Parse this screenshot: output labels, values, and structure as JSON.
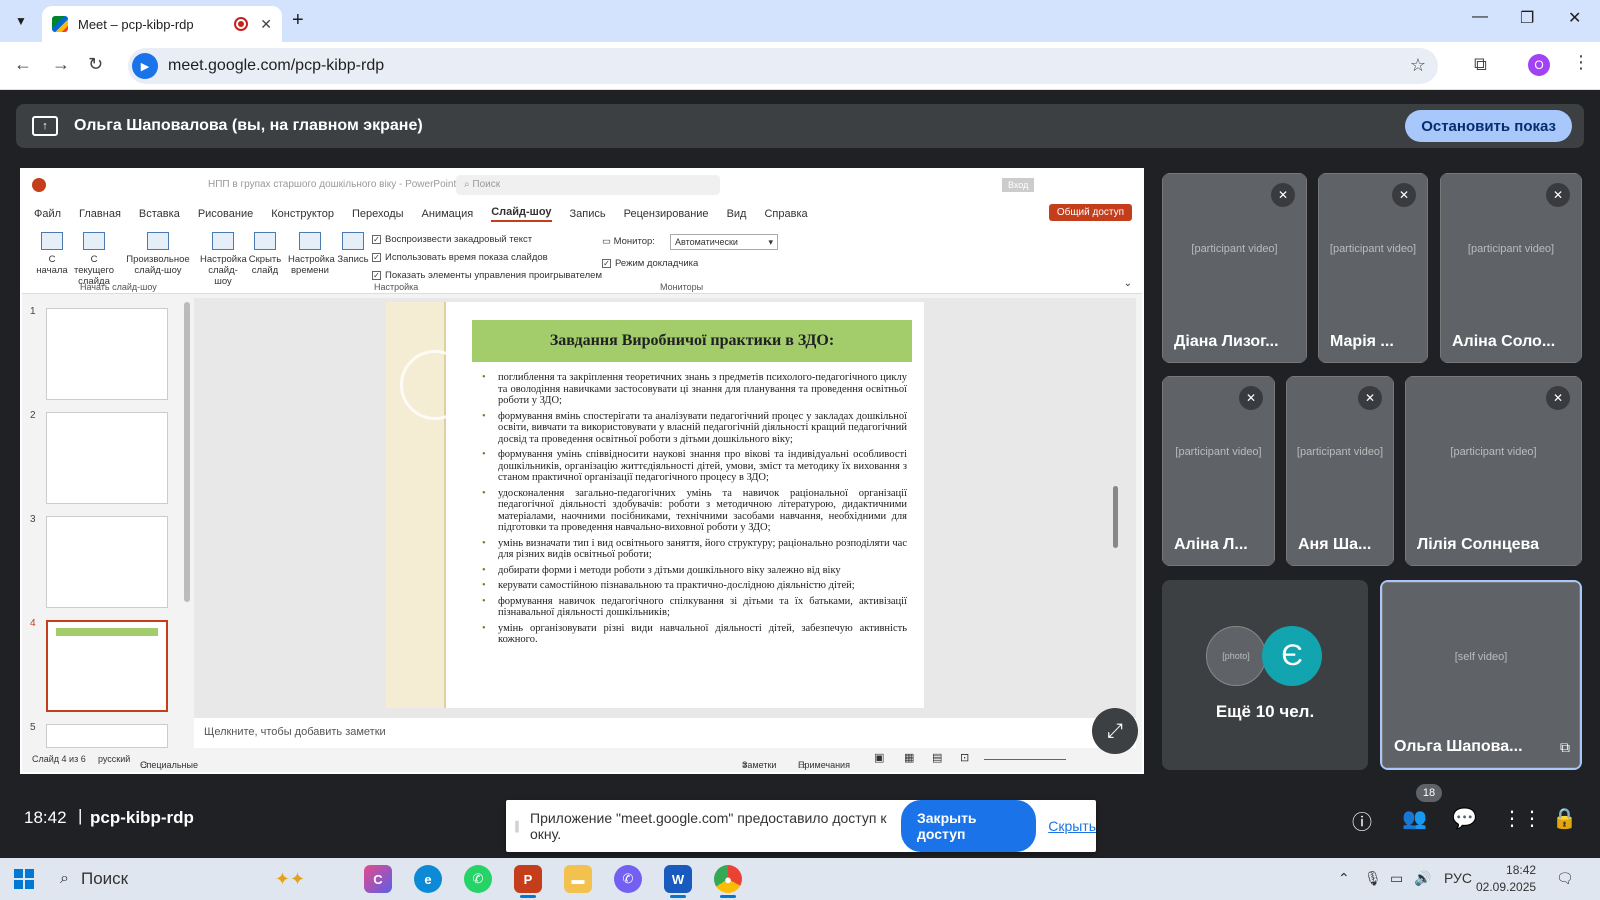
{
  "browser": {
    "tab_title": "Meet – pcp-kibp-rdp",
    "url": "meet.google.com/pcp-kibp-rdp",
    "profile_initial": "O"
  },
  "presentation": {
    "label": "Ольга Шаповалова (вы, на главном экране)",
    "stop_button": "Остановить показ"
  },
  "ppt": {
    "file_title": "НПП в групах старшого дошкільного віку - PowerPoint",
    "search_placeholder": "Поиск",
    "signin": "Вход",
    "menu": [
      "Файл",
      "Главная",
      "Вставка",
      "Рисование",
      "Конструктор",
      "Переходы",
      "Анимация",
      "Слайд-шоу",
      "Запись",
      "Рецензирование",
      "Вид",
      "Справка"
    ],
    "active_menu": "Слайд-шоу",
    "share_button": "Общий доступ",
    "ribbon": {
      "from_start": "С начала",
      "from_current": "С текущего слайда",
      "custom_show": "Произвольное слайд-шоу",
      "setup_show": "Настройка слайд-шоу",
      "hide_slide": "Скрыть слайд",
      "rehearse": "Настройка времени",
      "record": "Запись",
      "check_narration": "Воспроизвести закадровый текст",
      "check_timings": "Использовать время показа слайдов",
      "check_controls": "Показать элементы управления проигрывателем",
      "monitor_label": "Монитор:",
      "monitor_value": "Автоматически",
      "presenter_view": "Режим докладчика",
      "group_start": "Начать слайд-шоу",
      "group_setup": "Настройка",
      "group_monitors": "Мониторы"
    },
    "thumbs": [
      "1",
      "2",
      "3",
      "4",
      "5"
    ],
    "slide": {
      "heading": "Завдання Виробничої практики в ЗДО:",
      "bullets": [
        "поглиблення та закріплення теоретичних знань з предметів психолого-педагогічного циклу та оволодіння навичками застосовувати ці знання для планування та проведення освітньої роботи у ЗДО;",
        "формування вмінь спостерігати та аналізувати педагогічний процес у закладах дошкільної освіти, вивчати та використовувати у власній педагогічній діяльності кращий педагогічний досвід та проведення освітньої роботи з дітьми дошкільного віку;",
        "формування умінь співвідносити наукові знання про вікові та індивідуальні особливості дошкільників, організацію життєдіяльності дітей, умови, зміст та методику їх виховання з станом практичної організації педагогічного процесу в ЗДО;",
        "удосконалення загально-педагогічних умінь та навичок раціональної організації педагогічної діяльності здобувачів: роботи з методичною літературою, дидактичними матеріалами, наочними посібниками, технічними засобами навчання, необхідними для підготовки та проведення навчально-виховної роботи у ЗДО;",
        "умінь визначати тип і вид освітнього заняття, його структуру; раціонально розподіляти час для різних видів освітньої роботи;",
        "добирати форми і методи роботи з дітьми дошкільного віку залежно від віку",
        "керувати самостійною пізнавальною та практично-дослідною діяльністю дітей;",
        "формування навичок педагогічного спілкування зі дітьми та їх батьками, активізації пізнавальної діяльності дошкільників;",
        "умінь організовувати різні види навчальної діяльності дітей, забезпечую активність кожного."
      ]
    },
    "notes_placeholder": "Щелкните, чтобы добавить заметки",
    "status": {
      "slide_counter": "Слайд 4 из 6",
      "language": "русский",
      "accessibility": "Специальные возможности: все в порядке",
      "notes": "Заметки",
      "comments": "Примечания"
    }
  },
  "participants": [
    {
      "name": "Діана Лизог...",
      "muted": true
    },
    {
      "name": "Марія ...",
      "muted": true
    },
    {
      "name": "Аліна Соло...",
      "muted": true
    },
    {
      "name": "Аліна Л...",
      "muted": true
    },
    {
      "name": "Аня Ша...",
      "muted": true
    },
    {
      "name": "Лілія Солнцева",
      "muted": true
    }
  ],
  "more": {
    "label": "Ещё 10 чел.",
    "avatar_letter": "Є"
  },
  "self_tile": {
    "name": "Ольга Шапова..."
  },
  "meet_bar": {
    "time": "18:42",
    "separator": "|",
    "code": "pcp-kibp-rdp",
    "people_count": "18"
  },
  "share_notice": {
    "text": "Приложение \"meet.google.com\" предоставило доступ к окну.",
    "stop_button": "Закрыть доступ",
    "hide_link": "Скрыть"
  },
  "taskbar": {
    "search_label": "Поиск",
    "language": "РУС",
    "time": "18:42",
    "date": "02.09.2025"
  },
  "colors": {
    "accent": "#1a73e8",
    "slide_heading": "#a3cc6b",
    "ppt_accent": "#c43e1c"
  }
}
